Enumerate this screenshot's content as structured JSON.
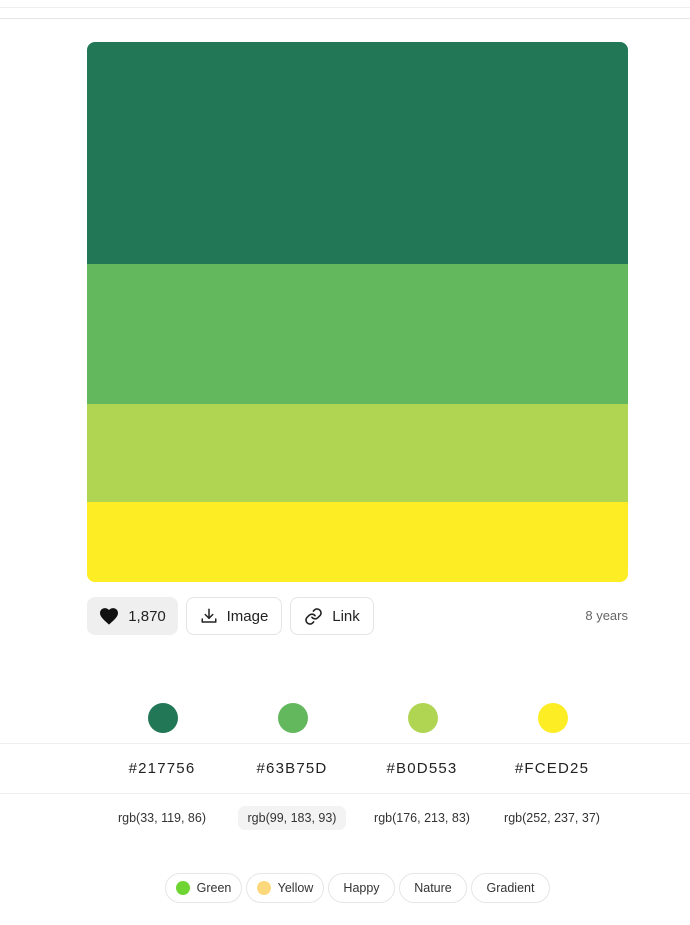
{
  "palette": {
    "colors": [
      {
        "hex": "#217756",
        "rgb": "rgb(33, 119, 86)"
      },
      {
        "hex": "#63B75D",
        "rgb": "rgb(99, 183, 93)"
      },
      {
        "hex": "#B0D553",
        "rgb": "rgb(176, 213, 83)"
      },
      {
        "hex": "#FCED25",
        "rgb": "rgb(252, 237, 37)"
      }
    ]
  },
  "actions": {
    "like_count": "1,870",
    "like_icon": "heart-icon",
    "image_label": "Image",
    "image_icon": "download-icon",
    "link_label": "Link",
    "link_icon": "link-icon",
    "age": "8 years"
  },
  "tags": [
    {
      "label": "Green",
      "dot_color": "#6fd533"
    },
    {
      "label": "Yellow",
      "dot_color": "#fbd97a"
    },
    {
      "label": "Happy"
    },
    {
      "label": "Nature"
    },
    {
      "label": "Gradient"
    }
  ]
}
